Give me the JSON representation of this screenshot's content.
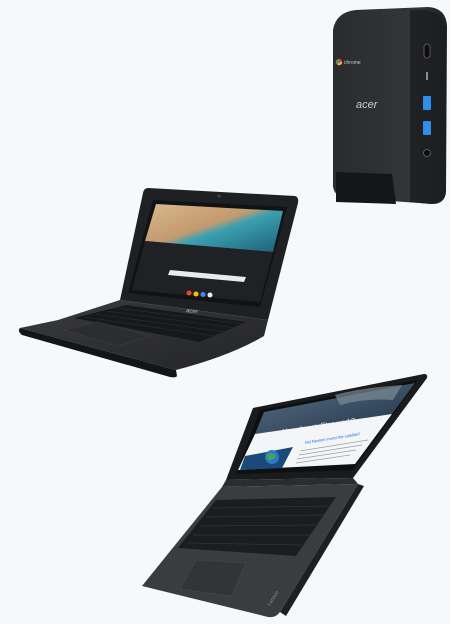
{
  "devices": {
    "chromebox": {
      "brand_label": "acer",
      "os_badge": "chrome"
    },
    "laptop_front": {
      "brand_label": "acer"
    },
    "laptop_angled": {
      "article_title": "How do satellites work?",
      "article_subtitle": "Did Newton invent the satellite?",
      "brand_label": "Lenovo"
    }
  },
  "colors": {
    "background": "#f7f8fa",
    "device_dark": "#2b2c30",
    "usb_blue": "#2f8fe8",
    "screen_sand": "#c9a77d",
    "screen_sea": "#2e8fa3"
  }
}
